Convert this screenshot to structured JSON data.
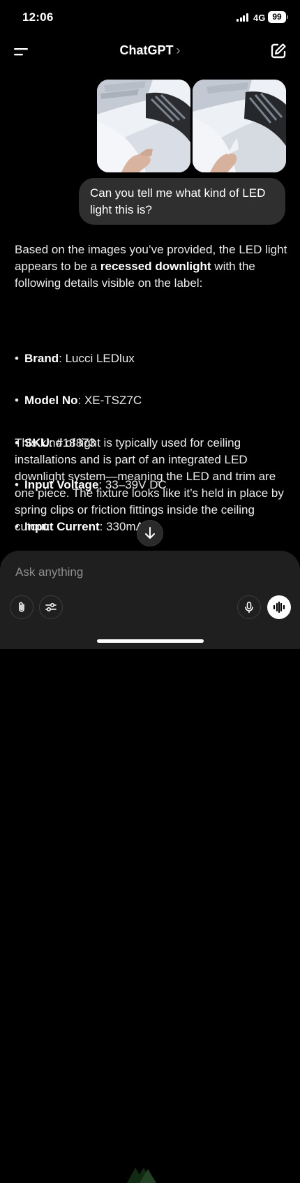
{
  "status_bar": {
    "time": "12:06",
    "network": "4G",
    "battery": "99"
  },
  "header": {
    "title": "ChatGPT",
    "chevron": "›"
  },
  "icons": [
    "menu-icon",
    "chevron-right-icon",
    "compose-icon",
    "arrow-down-icon",
    "paperclip-icon",
    "sliders-icon",
    "microphone-icon",
    "voice-waveform-icon"
  ],
  "user_message": {
    "text": "Can you tell me what kind of LED light this is?"
  },
  "assistant": {
    "intro_before": "Based on the images you’ve provided, the LED light appears to be a ",
    "intro_bold": "recessed downlight",
    "intro_after": " with the following details visible on the label:",
    "details": [
      {
        "label": "Brand",
        "value": ": Lucci LEDlux"
      },
      {
        "label": "Model No",
        "value": ": XE-TSZ7C"
      },
      {
        "label": "SKU",
        "value": ": #18873"
      },
      {
        "label": "Input Voltage",
        "value": ": 33–39V DC"
      },
      {
        "label": "Input Current",
        "value": ": 330mA"
      }
    ],
    "paragraph": "This kind of light is typically used for ceiling installations and is part of an integrated LED downlight system—meaning the LED and trim are one piece. The fixture looks like it’s held in place by spring clips or friction fittings inside the ceiling cutout."
  },
  "composer": {
    "placeholder": "Ask anything"
  },
  "colors": {
    "background": "#000000",
    "bubble": "#2f2f2f",
    "composer": "#1f1f1f"
  }
}
